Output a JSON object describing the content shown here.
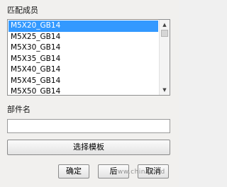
{
  "match_members": {
    "label": "匹配成员",
    "items": [
      "M5X20_GB14",
      "M5X25_GB14",
      "M5X30_GB14",
      "M5X35_GB14",
      "M5X40_GB14",
      "M5X45_GB14",
      "M5X50_GB14"
    ],
    "selected_index": 0
  },
  "part_name": {
    "label": "部件名",
    "value": ""
  },
  "buttons": {
    "select_template": "选择模板",
    "ok": "确定",
    "apply": "后",
    "cancel": "取消"
  },
  "watermark": "www.chinadmd"
}
